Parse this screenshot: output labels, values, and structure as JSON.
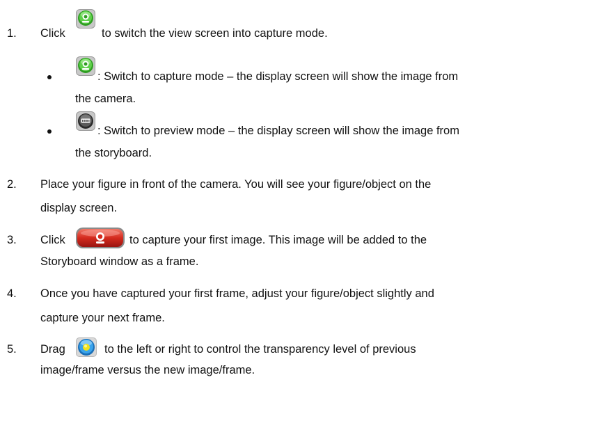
{
  "steps": [
    {
      "number": "1.",
      "before_icon": "Click",
      "icon": "capture-mode-icon",
      "after_icon": "to switch the view screen into capture mode.",
      "bullets": [
        {
          "icon": "capture-mode-icon",
          "line1": ": Switch to capture mode – the display screen will show the image from",
          "line2": "the camera."
        },
        {
          "icon": "preview-mode-icon",
          "line1": ": Switch to preview mode – the display screen will show the image from",
          "line2": "the storyboard."
        }
      ]
    },
    {
      "number": "2.",
      "line1": "Place your figure in front of the camera.   You will see your figure/object on the",
      "line2": "display screen."
    },
    {
      "number": "3.",
      "before_icon": "Click",
      "icon": "capture-button-icon",
      "after_icon": "to capture your first image.   This image will be added to the",
      "line2": "Storyboard window as a frame."
    },
    {
      "number": "4.",
      "line1": "Once you have captured your first frame, adjust your figure/object slightly and",
      "line2": "capture your next frame."
    },
    {
      "number": "5.",
      "before_icon": "Drag",
      "icon": "transparency-slider-icon",
      "after_icon": "to the left or right to control the transparency level of previous",
      "line2": "image/frame versus the new image/frame."
    }
  ],
  "colors": {
    "text": "#111111",
    "capture_green": "#3fae2a",
    "capture_red": "#d42a1e",
    "preview_gray": "#4a4a4a",
    "slider_blue": "#2a8fd8",
    "slider_yellow": "#f2e21a"
  }
}
